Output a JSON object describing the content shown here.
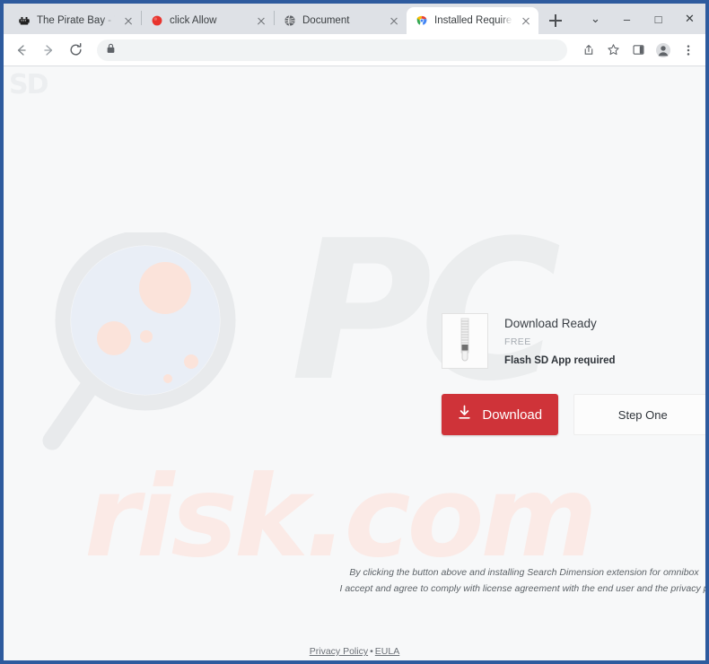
{
  "window": {
    "controls": [
      {
        "name": "tab-search",
        "glyph": "⌄"
      },
      {
        "name": "minimize",
        "glyph": "–"
      },
      {
        "name": "maximize",
        "glyph": "□"
      },
      {
        "name": "close",
        "glyph": "✕"
      }
    ]
  },
  "tabs": [
    {
      "title": "The Pirate Bay - The gal",
      "favicon": "pirate-ship-icon",
      "active": false
    },
    {
      "title": "click Allow",
      "favicon": "red-circle-icon",
      "active": false
    },
    {
      "title": "Document",
      "favicon": "globe-icon",
      "active": false
    },
    {
      "title": "Installed Required",
      "favicon": "chrome-icon",
      "active": true
    }
  ],
  "new_tab_label": "+",
  "toolbar": {
    "back_label": "←",
    "forward_label": "→",
    "reload_label": "↻",
    "omnibox_value": "",
    "omnibox_placeholder": "",
    "lock_icon": "lock-icon",
    "right_icons": [
      "share-icon",
      "bookmark-star-icon",
      "side-panel-icon",
      "profile-avatar-icon",
      "three-dot-menu-icon"
    ]
  },
  "page": {
    "brand_logo": "SD",
    "watermark": {
      "primary": "PC",
      "secondary": "risk.com",
      "glass_icon": "magnifying-glass-icon"
    },
    "download_card": {
      "file_icon": "zip-file-icon",
      "title": "Download Ready",
      "price": "FREE",
      "requirement": "Flash SD App required",
      "download_button": {
        "label": "Download",
        "icon": "download-arrow-icon",
        "color": "#cf3339"
      },
      "step_button": {
        "label": "Step One"
      }
    },
    "disclaimer": {
      "line1": "By clicking the button above and installing Search Dimension extension for omnibox",
      "line2": "I accept and agree to comply with license agreement with the end user and the privacy p"
    },
    "footer": {
      "privacy_label": "Privacy Policy",
      "separator": "•",
      "eula_label": "EULA"
    }
  },
  "colors": {
    "frame": "#2e5b9e",
    "accent_red": "#cf3339",
    "chrome_bg": "#dee1e6",
    "page_bg": "#f7f8f9"
  }
}
